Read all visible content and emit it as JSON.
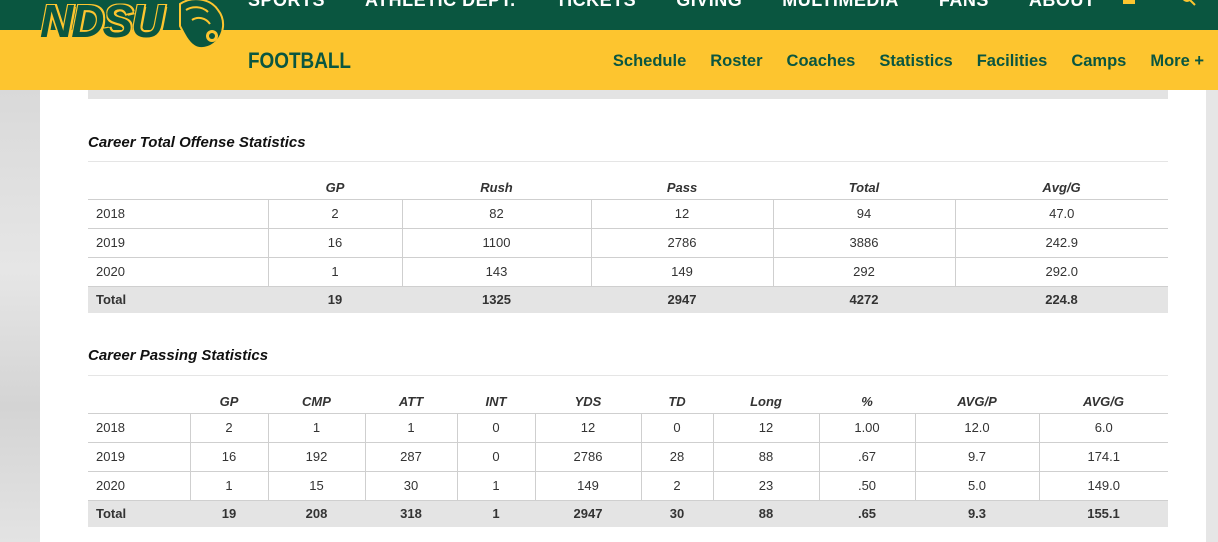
{
  "topnav": [
    "SPORTS",
    "ATHLETIC DEPT.",
    "TICKETS",
    "GIVING",
    "MULTIMEDIA",
    "FANS",
    "ABOUT"
  ],
  "logo_text": "NDSU",
  "sport_title": "FOOTBALL",
  "subnav": [
    "Schedule",
    "Roster",
    "Coaches",
    "Statistics",
    "Facilities",
    "Camps",
    "More +"
  ],
  "colors": {
    "green": "#0a5640",
    "gold": "#fdc52f"
  },
  "offense": {
    "title": "Career Total Offense Statistics",
    "headers": [
      "",
      "GP",
      "Rush",
      "Pass",
      "Total",
      "Avg/G"
    ],
    "rows": [
      [
        "2018",
        "2",
        "82",
        "12",
        "94",
        "47.0"
      ],
      [
        "2019",
        "16",
        "1100",
        "2786",
        "3886",
        "242.9"
      ],
      [
        "2020",
        "1",
        "143",
        "149",
        "292",
        "292.0"
      ]
    ],
    "total": [
      "Total",
      "19",
      "1325",
      "2947",
      "4272",
      "224.8"
    ]
  },
  "passing": {
    "title": "Career Passing Statistics",
    "headers": [
      "",
      "GP",
      "CMP",
      "ATT",
      "INT",
      "YDS",
      "TD",
      "Long",
      "%",
      "AVG/P",
      "AVG/G"
    ],
    "rows": [
      [
        "2018",
        "2",
        "1",
        "1",
        "0",
        "12",
        "0",
        "12",
        "1.00",
        "12.0",
        "6.0"
      ],
      [
        "2019",
        "16",
        "192",
        "287",
        "0",
        "2786",
        "28",
        "88",
        ".67",
        "9.7",
        "174.1"
      ],
      [
        "2020",
        "1",
        "15",
        "30",
        "1",
        "149",
        "2",
        "23",
        ".50",
        "5.0",
        "149.0"
      ]
    ],
    "total": [
      "Total",
      "19",
      "208",
      "318",
      "1",
      "2947",
      "30",
      "88",
      ".65",
      "9.3",
      "155.1"
    ]
  }
}
